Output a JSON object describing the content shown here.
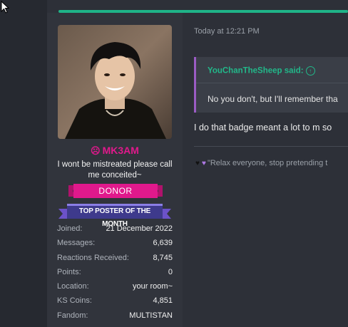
{
  "post": {
    "timestamp": "Today at 12:21 PM",
    "quote": {
      "author_line": "YouChanTheSheep said:",
      "body": "No you don't, but I'll remember tha"
    },
    "text": "I do that badge meant a lot to m so",
    "signature": "\"Relax everyone, stop pretending t"
  },
  "user": {
    "emoji": "☹",
    "username": "MK3AM",
    "title": "I wont be mistreated please call me conceited~",
    "donor_banner": "DONOR",
    "top_poster_banner": "TOP POSTER OF THE MONTH",
    "stats": [
      {
        "label": "Joined:",
        "value": "21 December 2022"
      },
      {
        "label": "Messages:",
        "value": "6,639"
      },
      {
        "label": "Reactions Received:",
        "value": "8,745"
      },
      {
        "label": "Points:",
        "value": "0"
      },
      {
        "label": "Location:",
        "value": "your room~"
      },
      {
        "label": "KS Coins:",
        "value": "4,851"
      },
      {
        "label": "Fandom:",
        "value": "MULTISTAN"
      }
    ]
  },
  "colors": {
    "accent_green": "#1fb388",
    "username_pink": "#e0198c",
    "quote_border": "#9b5cc4",
    "donor_pink": "#e0198c",
    "banner_purple": "#5a3fa8"
  },
  "icons": {
    "quote_link": "arrow-up-circle-icon",
    "signature_hearts": [
      "black-heart-icon",
      "purple-heart-icon"
    ]
  }
}
